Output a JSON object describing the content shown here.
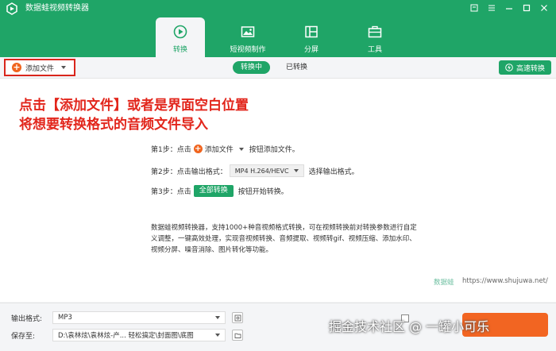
{
  "app": {
    "title": "数据蛙视频转换器"
  },
  "nav": {
    "tabs": [
      {
        "label": "转换",
        "icon": "convert-icon"
      },
      {
        "label": "短视频制作",
        "icon": "image-icon"
      },
      {
        "label": "分屏",
        "icon": "split-icon"
      },
      {
        "label": "工具",
        "icon": "toolbox-icon"
      }
    ]
  },
  "toolbar": {
    "add_file_label": "添加文件",
    "subtabs": [
      "转换中",
      "已转换"
    ],
    "fast_convert_label": "高速转换"
  },
  "annotation": {
    "line1": "点击【添加文件】或者是界面空白位置",
    "line2": "将想要转换格式的音频文件导入"
  },
  "steps": {
    "s1_prefix": "第1步：点击",
    "s1_button": "添加文件",
    "s1_suffix": "按钮添加文件。",
    "s2_prefix": "第2步：点击输出格式：",
    "s2_format": "MP4 H.264/HEVC",
    "s2_suffix": "选择输出格式。",
    "s3_prefix": "第3步：点击",
    "s3_button": "全部转换",
    "s3_suffix": "按钮开始转换。"
  },
  "description": "数据蛙视频转换器，支持1000+种音视频格式转换，可在视频转换前对转换参数进行自定义调整，一键高效处理，实现音视频转换、音频提取、视频转gif、视频压缩、添加水印、视频分屏、噪音消除、图片转化等功能。",
  "brand_watermark": {
    "name": "数据蛙",
    "url": "https://www.shujuwa.net/"
  },
  "bottom": {
    "output_format_label": "输出格式:",
    "output_format_value": "MP3",
    "save_to_label": "保存至:",
    "save_to_value": "D:\\袁林炫\\袁林炫-产... 轻松搞定\\封面图\\底图"
  },
  "overlay_watermark": "掘金技术社区 @ 一罐小可乐",
  "colors": {
    "brand_green": "#1fa567",
    "accent_orange": "#f26522",
    "annotation_red": "#e2261c"
  }
}
